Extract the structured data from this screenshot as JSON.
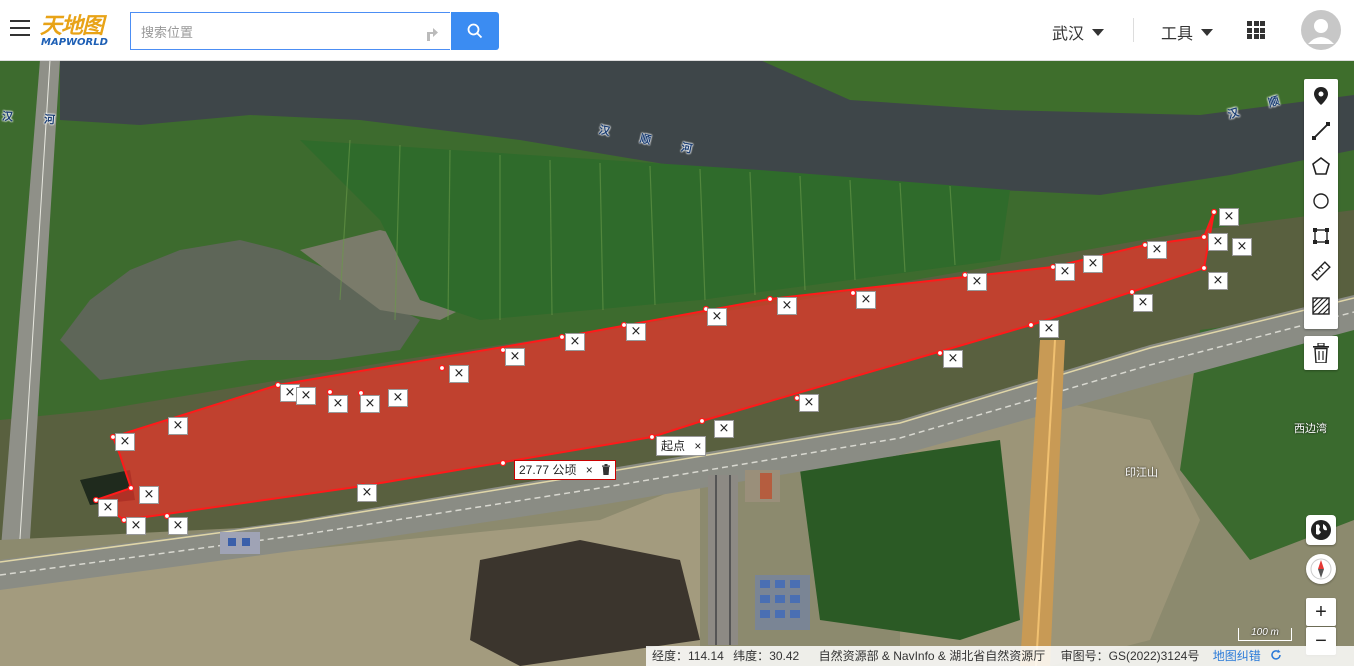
{
  "header": {
    "logo_cn": "天地图",
    "logo_en": "MAPWORLD",
    "search_placeholder": "搜索位置",
    "city": "武汉",
    "tools": "工具"
  },
  "map": {
    "river_labels": [
      "汉　河",
      "汉　顺　河",
      "汉　顺　河"
    ],
    "place_labels": [
      "西边湾",
      "印江山"
    ],
    "area_label": "27.77 公顷",
    "start_label": "起点",
    "delete_symbol": "×"
  },
  "toolbar": {
    "icons": [
      "marker-icon",
      "line-icon",
      "polygon-icon",
      "circle-icon",
      "rectangle-icon",
      "ruler-icon",
      "hatch-icon",
      "trash-icon"
    ]
  },
  "controls": {
    "zoom_in": "+",
    "zoom_out": "−"
  },
  "status": {
    "lng_label": "经度：",
    "lng_value": "114.14",
    "lat_label": "纬度：",
    "lat_value": "30.42",
    "attribution": "自然资源部 & NavInfo & 湖北省自然资源厅",
    "approval": "审图号：GS(2022)3124号",
    "correction": "地图纠错"
  },
  "scale": "100 m",
  "colors": {
    "accent": "#3b8cf2",
    "polygon_fill": "#e8352a",
    "polygon_stroke": "#ff1a1a",
    "river": "#3e4649",
    "vegetation": "#3f7a33"
  }
}
